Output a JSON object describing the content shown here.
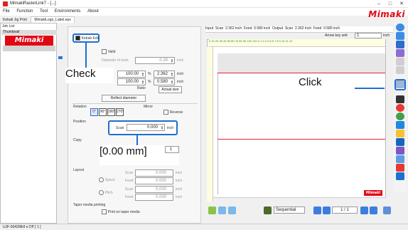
{
  "window": {
    "title": "MimakiRasterLink7 - [...]",
    "minimize": "–",
    "maximize": "□",
    "close": "✕"
  },
  "menu": [
    "File",
    "Function",
    "Tool",
    "Environments",
    "About"
  ],
  "brand": "Mimaki",
  "tabs": [
    "Kebab Jig Print",
    "MimakiLogo_Label.eps"
  ],
  "job_list": {
    "title": "Job List",
    "thumbnail_header": "Thumbnail",
    "thumbnail_text": "Mimaki"
  },
  "settings": {
    "kebab_edit": {
      "label": "Kebab Edit",
      "checked": true
    },
    "valid": {
      "label": "Valid",
      "checked": false
    },
    "diameter": {
      "label": "Diameter of work",
      "value": "0.39",
      "unit": "inch"
    },
    "scale_x": {
      "value": "100.00",
      "unit": "%"
    },
    "scale_y": {
      "value": "100.00",
      "unit": "%"
    },
    "size_w": {
      "value": "2.362",
      "unit": "inch"
    },
    "size_h": {
      "value": "0.580",
      "unit": "inch"
    },
    "ratio_label": "Ratio",
    "actual_size_button": "Actual size",
    "reflect_diameter_button": "Reflect diameter",
    "rotation_label": "Rotation",
    "rotation_options": [
      "0°",
      "90°",
      "180°",
      "270°"
    ],
    "mirror_label": "Mirror",
    "reverse": {
      "label": "Reverse",
      "checked": false
    },
    "position_label": "Position",
    "scan": {
      "label": "Scan",
      "value": "0.000",
      "unit": "inch"
    },
    "copy_label": "Copy",
    "copy_value": "1",
    "layout_label": "Layout",
    "space": {
      "label": "Space",
      "scan_label": "Scan",
      "feed_label": "Feed",
      "scan_value": "0.000",
      "feed_value": "0.000",
      "unit": "inch"
    },
    "pitch": {
      "label": "Pitch",
      "scan_label": "Scan",
      "feed_label": "Feed",
      "scan_value": "0.000",
      "feed_value": "0.000",
      "unit": "inch"
    },
    "taper_label": "Taper media printing",
    "taper": {
      "label": "Print on taper media",
      "checked": false
    }
  },
  "callouts": {
    "check": "Check",
    "click": "Click",
    "value": "[0.00 mm]"
  },
  "preview": {
    "input_label": "Input",
    "input_scan_label": "Scan",
    "input_scan_value": "2.362",
    "input_scan_unit": "inch",
    "input_feed_label": "Feed",
    "input_feed_value": "0.580",
    "input_feed_unit": "inch",
    "output_label": "Output",
    "output_scan_label": "Scan",
    "output_scan_value": "2.362",
    "output_scan_unit": "inch",
    "output_feed_label": "Feed",
    "output_feed_value": "0.580",
    "output_feed_unit": "inch",
    "arrow_key_unit_label": "Arrow key unit",
    "arrow_key_unit_value": "1",
    "arrow_key_unit_unit": "inch",
    "ruler_ticks": "0 10 20 30 40 50 60 70 80 90 100 110 0 1 2 3 4 5 6 7 8 9 10 11 12",
    "mimaki_badge": "Mimaki"
  },
  "bottom": {
    "sequential": "Sequential",
    "page": "1 / 1"
  },
  "statusbar": "UJF-6042MkII e DP [ 1 ]",
  "colors": {
    "accent": "#1e6fd1",
    "brand": "#e30613"
  }
}
